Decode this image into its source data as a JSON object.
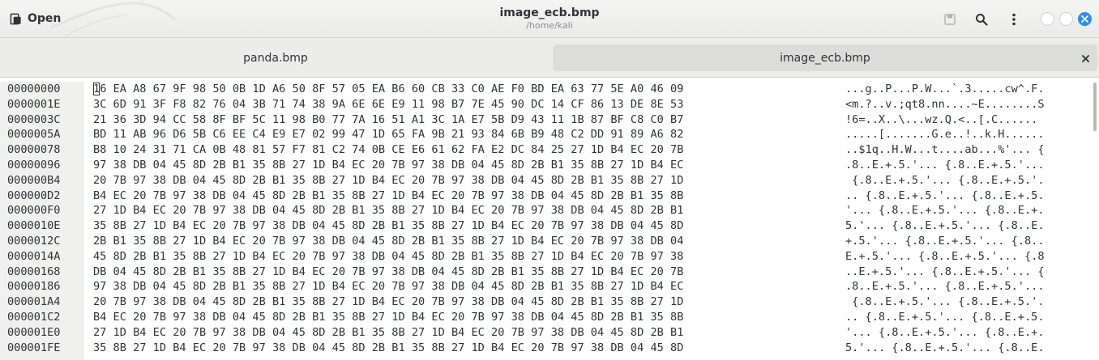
{
  "header": {
    "open_label": "Open",
    "title": "image_ecb.bmp",
    "subtitle": "/home/kali",
    "icons": [
      "document-open-icon",
      "save-icon",
      "search-icon",
      "kebab-menu-icon",
      "minimize-icon",
      "maximize-icon",
      "close-icon"
    ],
    "accent_color": "#2a8ef0"
  },
  "tabs": [
    {
      "label": "panda.bmp",
      "active": false
    },
    {
      "label": "image_ecb.bmp",
      "active": true,
      "close_glyph": "×"
    }
  ],
  "hex": {
    "cursor_first_char": "1",
    "rows": [
      {
        "offset": "00000000",
        "hex": "16 EA A8 67 9F 98 50 0B 1D A6 50 8F 57 05 EA B6 60 CB 33 C0 AE F0 BD EA 63 77 5E A0 46 09",
        "ascii": "...g..P...P.W...`.3.....cw^.F."
      },
      {
        "offset": "0000001E",
        "hex": "3C 6D 91 3F F8 82 76 04 3B 71 74 38 9A 6E 6E E9 11 98 B7 7E 45 90 DC 14 CF 86 13 DE 8E 53",
        "ascii": "<m.?..v.;qt8.nn....~E........S"
      },
      {
        "offset": "0000003C",
        "hex": "21 36 3D 94 CC 58 8F BF 5C 11 98 B0 77 7A 16 51 A1 3C 1A E7 5B D9 43 11 1B 87 BF C8 C0 B7",
        "ascii": "!6=..X..\\...wz.Q.<..[.C......"
      },
      {
        "offset": "0000005A",
        "hex": "BD 11 AB 96 D6 5B C6 EE C4 E9 E7 02 99 47 1D 65 FA 9B 21 93 84 6B B9 48 C2 DD 91 89 A6 82",
        "ascii": ".....[.......G.e..!..k.H......"
      },
      {
        "offset": "00000078",
        "hex": "B8 10 24 31 71 CA 0B 48 81 57 F7 81 C2 74 0B CE E6 61 62 FA E2 DC 84 25 27 1D B4 EC 20 7B",
        "ascii": "..$1q..H.W...t....ab...%'... {"
      },
      {
        "offset": "00000096",
        "hex": "97 38 DB 04 45 8D 2B B1 35 8B 27 1D B4 EC 20 7B 97 38 DB 04 45 8D 2B B1 35 8B 27 1D B4 EC",
        "ascii": ".8..E.+.5.'... {.8..E.+.5.'..."
      },
      {
        "offset": "000000B4",
        "hex": "20 7B 97 38 DB 04 45 8D 2B B1 35 8B 27 1D B4 EC 20 7B 97 38 DB 04 45 8D 2B B1 35 8B 27 1D",
        "ascii": " {.8..E.+.5.'... {.8..E.+.5.'."
      },
      {
        "offset": "000000D2",
        "hex": "B4 EC 20 7B 97 38 DB 04 45 8D 2B B1 35 8B 27 1D B4 EC 20 7B 97 38 DB 04 45 8D 2B B1 35 8B",
        "ascii": ".. {.8..E.+.5.'... {.8..E.+.5."
      },
      {
        "offset": "000000F0",
        "hex": "27 1D B4 EC 20 7B 97 38 DB 04 45 8D 2B B1 35 8B 27 1D B4 EC 20 7B 97 38 DB 04 45 8D 2B B1",
        "ascii": "'... {.8..E.+.5.'... {.8..E.+."
      },
      {
        "offset": "0000010E",
        "hex": "35 8B 27 1D B4 EC 20 7B 97 38 DB 04 45 8D 2B B1 35 8B 27 1D B4 EC 20 7B 97 38 DB 04 45 8D",
        "ascii": "5.'... {.8..E.+.5.'... {.8..E."
      },
      {
        "offset": "0000012C",
        "hex": "2B B1 35 8B 27 1D B4 EC 20 7B 97 38 DB 04 45 8D 2B B1 35 8B 27 1D B4 EC 20 7B 97 38 DB 04",
        "ascii": "+.5.'... {.8..E.+.5.'... {.8.."
      },
      {
        "offset": "0000014A",
        "hex": "45 8D 2B B1 35 8B 27 1D B4 EC 20 7B 97 38 DB 04 45 8D 2B B1 35 8B 27 1D B4 EC 20 7B 97 38",
        "ascii": "E.+.5.'... {.8..E.+.5.'... {.8"
      },
      {
        "offset": "00000168",
        "hex": "DB 04 45 8D 2B B1 35 8B 27 1D B4 EC 20 7B 97 38 DB 04 45 8D 2B B1 35 8B 27 1D B4 EC 20 7B",
        "ascii": "..E.+.5.'... {.8..E.+.5.'... {"
      },
      {
        "offset": "00000186",
        "hex": "97 38 DB 04 45 8D 2B B1 35 8B 27 1D B4 EC 20 7B 97 38 DB 04 45 8D 2B B1 35 8B 27 1D B4 EC",
        "ascii": ".8..E.+.5.'... {.8..E.+.5.'..."
      },
      {
        "offset": "000001A4",
        "hex": "20 7B 97 38 DB 04 45 8D 2B B1 35 8B 27 1D B4 EC 20 7B 97 38 DB 04 45 8D 2B B1 35 8B 27 1D",
        "ascii": " {.8..E.+.5.'... {.8..E.+.5.'."
      },
      {
        "offset": "000001C2",
        "hex": "B4 EC 20 7B 97 38 DB 04 45 8D 2B B1 35 8B 27 1D B4 EC 20 7B 97 38 DB 04 45 8D 2B B1 35 8B",
        "ascii": ".. {.8..E.+.5.'... {.8..E.+.5."
      },
      {
        "offset": "000001E0",
        "hex": "27 1D B4 EC 20 7B 97 38 DB 04 45 8D 2B B1 35 8B 27 1D B4 EC 20 7B 97 38 DB 04 45 8D 2B B1",
        "ascii": "'... {.8..E.+.5.'... {.8..E.+."
      },
      {
        "offset": "000001FE",
        "hex": "35 8B 27 1D B4 EC 20 7B 97 38 DB 04 45 8D 2B B1 35 8B 27 1D B4 EC 20 7B 97 38 DB 04 45 8D",
        "ascii": "5.'... {.8..E.+.5.'... {.8..E."
      }
    ]
  }
}
